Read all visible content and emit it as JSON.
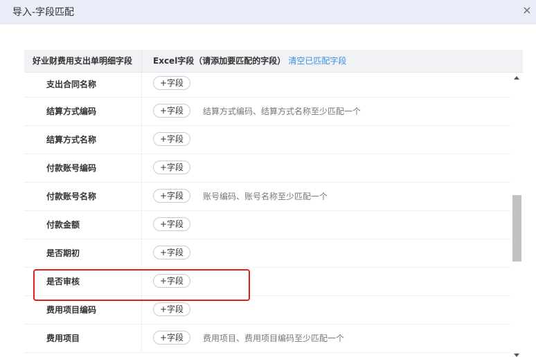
{
  "dialog": {
    "title": "导入-字段匹配",
    "close_icon": "×"
  },
  "table": {
    "header": {
      "left_label": "好业财费用支出单明细字段",
      "right_label": "Excel字段（请添加要匹配的字段）",
      "clear_link": "清空已匹配字段"
    },
    "rows": [
      {
        "name": "支出合同名称",
        "button": "+字段",
        "hint": ""
      },
      {
        "name": "结算方式编码",
        "button": "+字段",
        "hint": "结算方式编码、结算方式名称至少匹配一个"
      },
      {
        "name": "结算方式名称",
        "button": "+字段",
        "hint": ""
      },
      {
        "name": "付款账号编码",
        "button": "+字段",
        "hint": ""
      },
      {
        "name": "付款账号名称",
        "button": "+字段",
        "hint": "账号编码、账号名称至少匹配一个"
      },
      {
        "name": "付款金额",
        "button": "+字段",
        "hint": ""
      },
      {
        "name": "是否期初",
        "button": "+字段",
        "hint": ""
      },
      {
        "name": "是否审核",
        "button": "+字段",
        "hint": ""
      },
      {
        "name": "费用项目编码",
        "button": "+字段",
        "hint": ""
      },
      {
        "name": "费用项目",
        "button": "+字段",
        "hint": "费用项目、费用项目编码至少匹配一个"
      }
    ]
  },
  "colors": {
    "title_bar": "#e8edf7",
    "link": "#3a8ee6",
    "highlight": "#e02020"
  }
}
